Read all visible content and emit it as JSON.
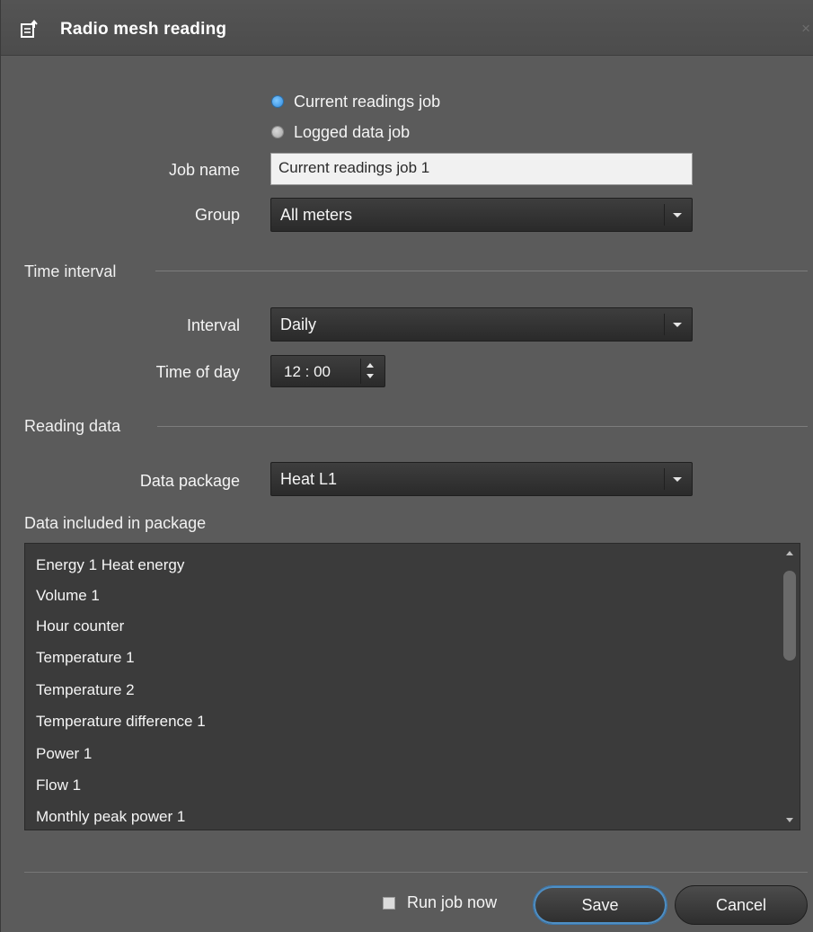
{
  "window": {
    "title": "Radio mesh reading",
    "close_glyph": "×"
  },
  "job_type": {
    "options": [
      {
        "label": "Current readings job",
        "selected": true
      },
      {
        "label": "Logged data job",
        "selected": false
      }
    ]
  },
  "fields": {
    "job_name_label": "Job name",
    "job_name_value": "Current readings job 1",
    "group_label": "Group",
    "group_value": "All meters"
  },
  "time_interval": {
    "section_title": "Time interval",
    "interval_label": "Interval",
    "interval_value": "Daily",
    "time_of_day_label": "Time of day",
    "time_of_day_value": "12 : 00"
  },
  "reading_data": {
    "section_title": "Reading data",
    "data_package_label": "Data package",
    "data_package_value": "Heat L1",
    "included_label": "Data included in package",
    "items": [
      "Energy 1 Heat energy",
      "Volume 1",
      "Hour counter",
      "Temperature 1",
      "Temperature 2",
      "Temperature difference 1",
      "Power 1",
      "Flow 1",
      "Monthly peak power 1"
    ]
  },
  "footer": {
    "run_job_now_label": "Run job now",
    "run_job_now_checked": false,
    "save_label": "Save",
    "cancel_label": "Cancel"
  },
  "colors": {
    "background": "#5b5b5b",
    "control_dark": "#2e2e2e",
    "accent_blue": "#2f8be0",
    "save_border": "#4f8fc4"
  }
}
